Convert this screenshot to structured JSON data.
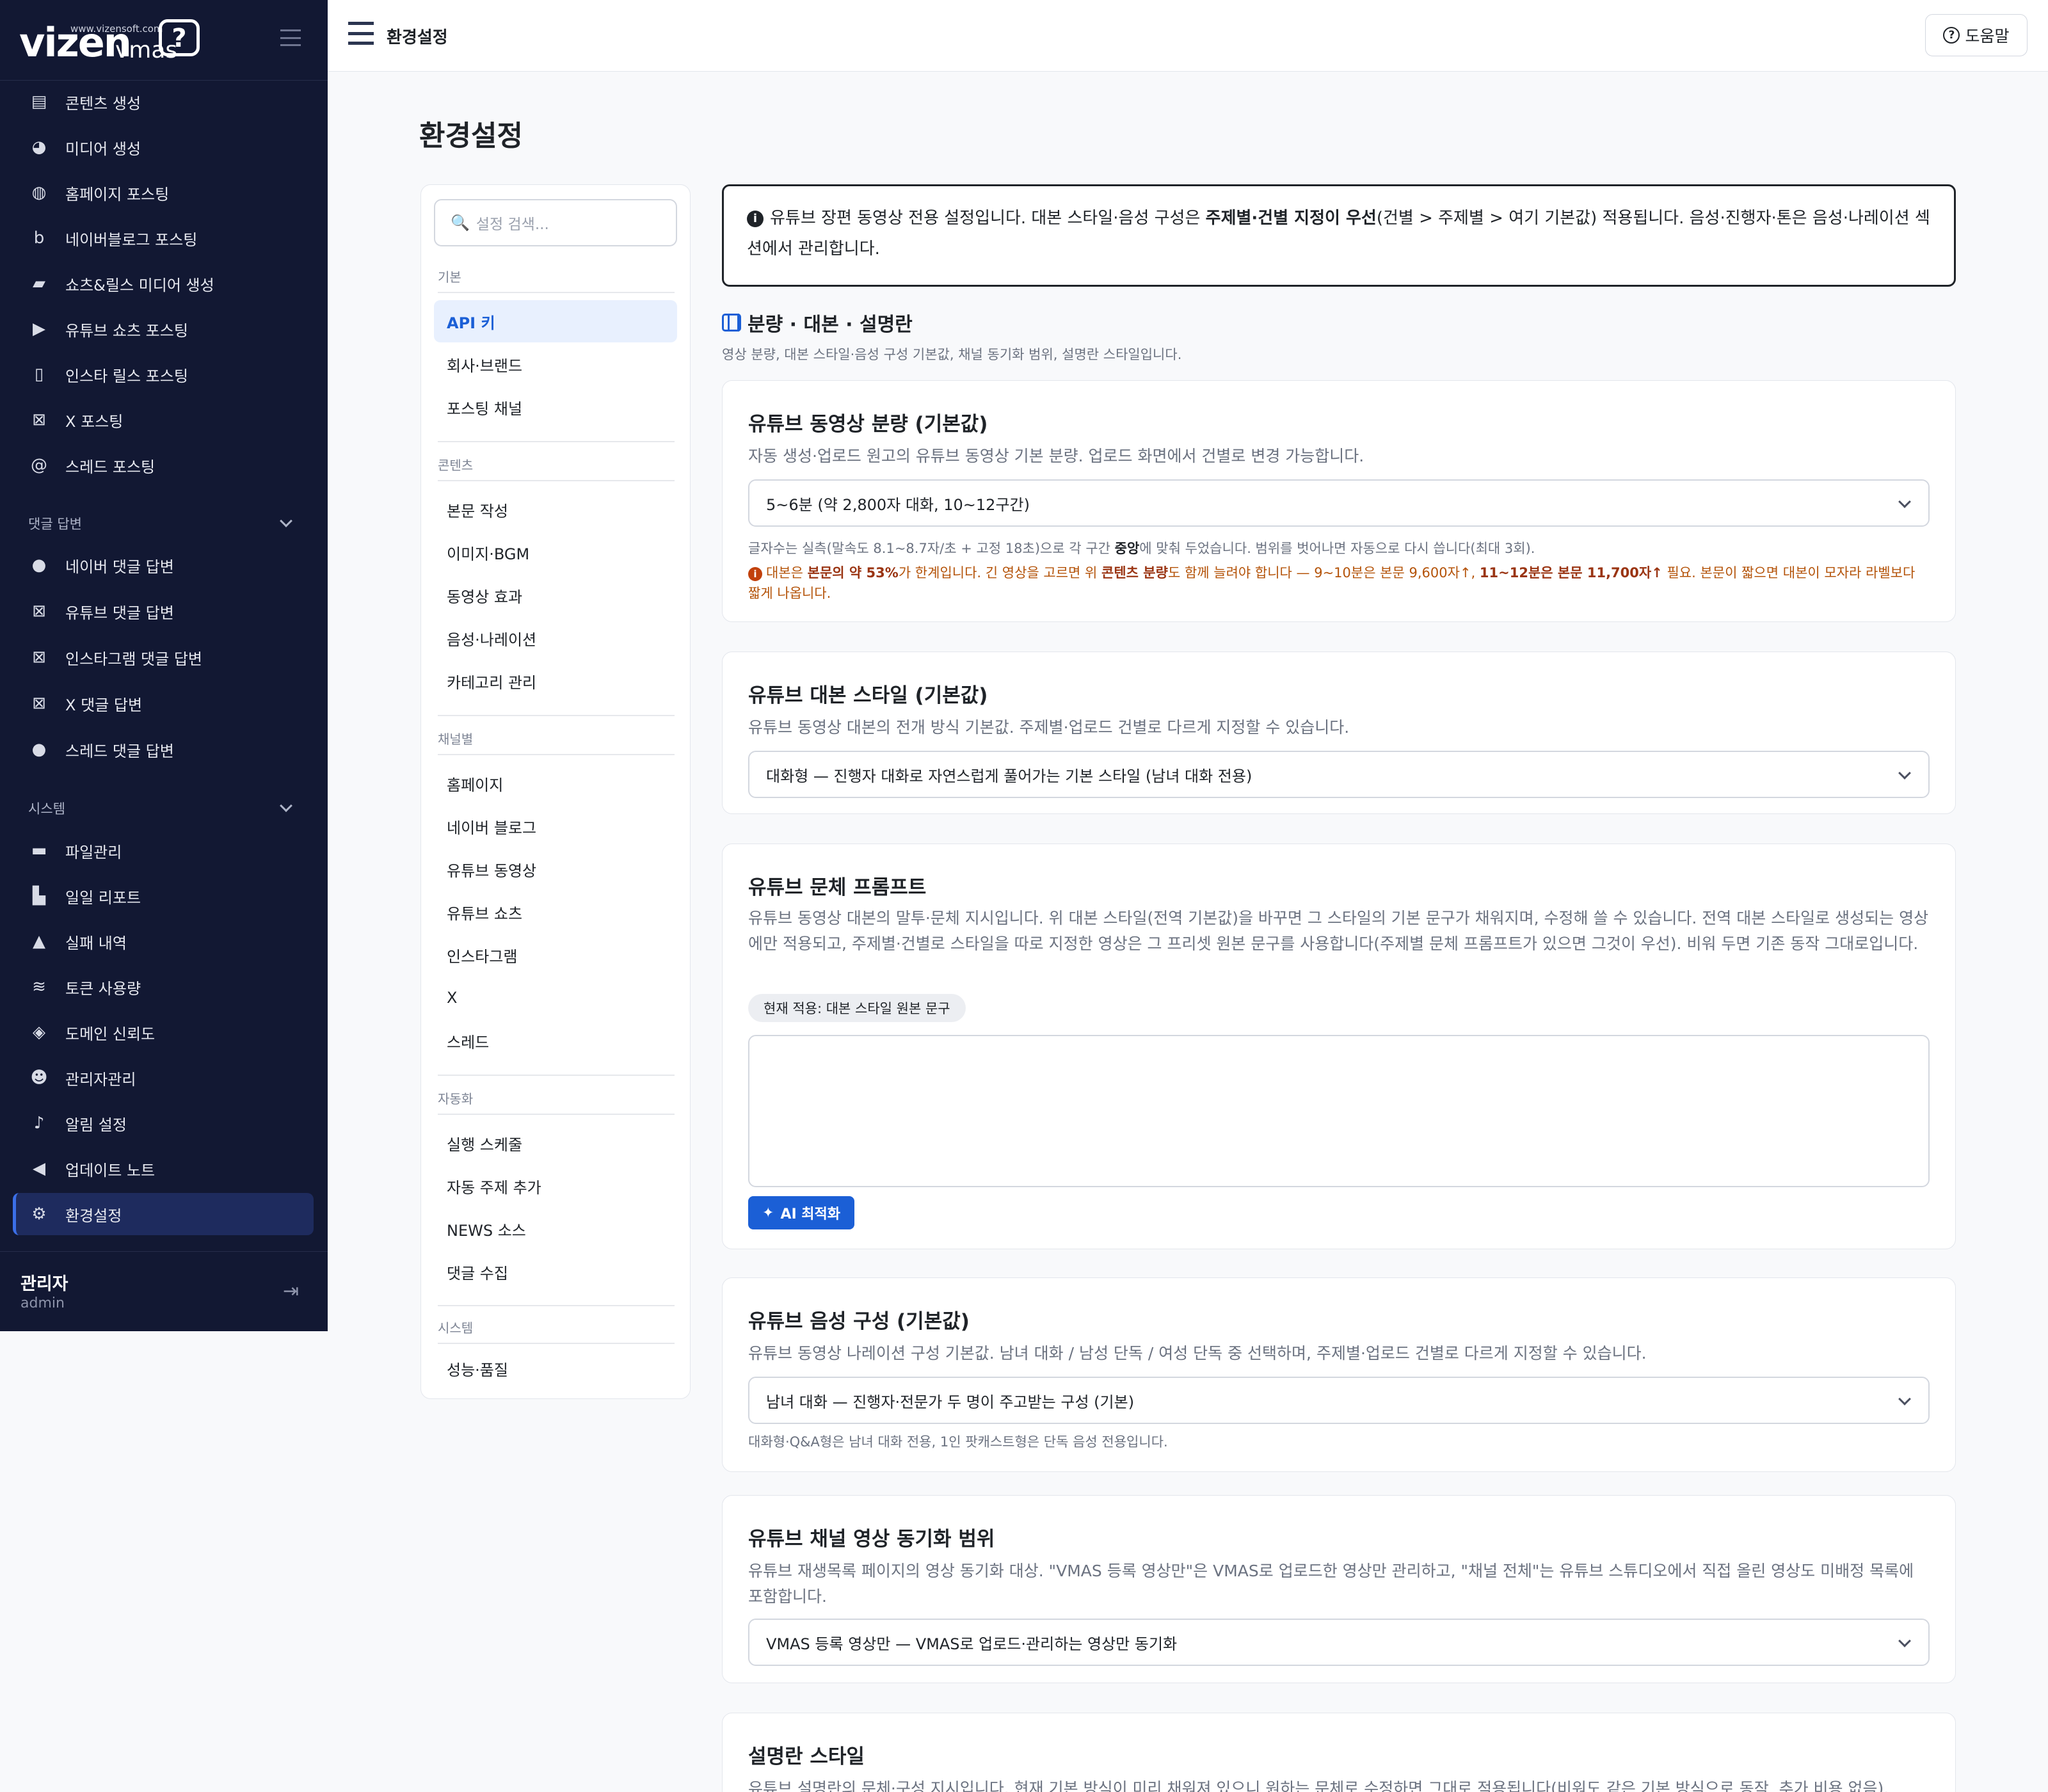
{
  "brand": {
    "logo_text": "vizen",
    "logo_sub": "vmas",
    "logo_url": "www.vizensoft.com"
  },
  "sidebar": {
    "items_top": [
      {
        "label": "콘텐츠 생성",
        "icon": "newspaper-icon"
      },
      {
        "label": "미디어 생성",
        "icon": "palette-icon"
      },
      {
        "label": "홈페이지 포스팅",
        "icon": "globe-icon"
      },
      {
        "label": "네이버블로그 포스팅",
        "icon": "blog-icon"
      },
      {
        "label": "쇼츠&릴스 미디어 생성",
        "icon": "clapperboard-icon"
      },
      {
        "label": "유튜브 쇼츠 포스팅",
        "icon": "play-icon"
      },
      {
        "label": "인스타 릴스 포스팅",
        "icon": "mobile-icon"
      },
      {
        "label": "X 포스팅",
        "icon": "x-icon"
      },
      {
        "label": "스레드 포스팅",
        "icon": "at-icon"
      }
    ],
    "group_comments": "댓글 답변",
    "items_comments": [
      {
        "label": "네이버 댓글 답변",
        "icon": "comment-icon"
      },
      {
        "label": "유튜브 댓글 답변",
        "icon": "x-icon"
      },
      {
        "label": "인스타그램 댓글 답변",
        "icon": "x-icon"
      },
      {
        "label": "X 댓글 답변",
        "icon": "x-icon"
      },
      {
        "label": "스레드 댓글 답변",
        "icon": "comments-icon"
      }
    ],
    "group_system": "시스템",
    "items_system": [
      {
        "label": "파일관리",
        "icon": "folder-icon"
      },
      {
        "label": "일일 리포트",
        "icon": "chart-icon"
      },
      {
        "label": "실패 내역",
        "icon": "warning-icon"
      },
      {
        "label": "토큰 사용량",
        "icon": "coins-icon"
      },
      {
        "label": "도메인 신뢰도",
        "icon": "shield-icon"
      },
      {
        "label": "관리자관리",
        "icon": "user-gear-icon"
      },
      {
        "label": "알림 설정",
        "icon": "bell-icon"
      },
      {
        "label": "업데이트 노트",
        "icon": "megaphone-icon"
      },
      {
        "label": "환경설정",
        "icon": "gear-icon",
        "active": true
      }
    ],
    "user": {
      "name": "관리자",
      "role": "admin"
    }
  },
  "topbar": {
    "breadcrumb": "환경설정",
    "help": "도움말"
  },
  "page_title": "환경설정",
  "settings_nav": {
    "search_placeholder": "설정 검색...",
    "groups": [
      {
        "title": "기본",
        "items": [
          "API 키",
          "회사·브랜드",
          "포스팅 채널"
        ]
      },
      {
        "title": "콘텐츠",
        "items": [
          "본문 작성",
          "이미지·BGM",
          "동영상 효과",
          "음성·나레이션",
          "카테고리 관리"
        ]
      },
      {
        "title": "채널별",
        "items": [
          "홈페이지",
          "네이버 블로그",
          "유튜브 동영상",
          "유튜브 쇼츠",
          "인스타그램",
          "X",
          "스레드"
        ]
      },
      {
        "title": "자동화",
        "items": [
          "실행 스케줄",
          "자동 주제 추가",
          "NEWS 소스",
          "댓글 수집"
        ]
      },
      {
        "title": "시스템",
        "items": [
          "성능·품질"
        ]
      }
    ],
    "active_item": "API 키"
  },
  "notice": {
    "text_a": "유튜브 장편 동영상 전용 설정입니다. 대본 스타일·음성 구성은 ",
    "text_bold": "주제별·건별 지정이 우선",
    "text_b": "(건별 > 주제별 > 여기 기본값) 적용됩니다. 음성·진행자·톤은 음성·나레이션 섹션에서 관리합니다."
  },
  "section": {
    "title": "분량 · 대본 · 설명란",
    "subtitle": "영상 분량, 대본 스타일·음성 구성 기본값, 채널 동기화 범위, 설명란 스타일입니다."
  },
  "cards": {
    "length": {
      "title": "유튜브 동영상 분량 (기본값)",
      "desc": "자동 생성·업로드 원고의 유튜브 동영상 기본 분량. 업로드 화면에서 건별로 변경 가능합니다.",
      "selected": "5~6분 (약 2,800자 대화, 10~12구간)",
      "note_a": "글자수는 실측(말속도 8.1~8.7자/초 + 고정 18초)으로 각 구간 ",
      "note_bold": "중앙",
      "note_b": "에 맞춰 두었습니다. 범위를 벗어나면 자동으로 다시 씁니다(최대 3회).",
      "warn_a": "대본은 ",
      "warn_bold1": "본문의 약 53%",
      "warn_b": "가 한계입니다. 긴 영상을 고르면 위 ",
      "warn_bold2": "콘텐츠 분량",
      "warn_c": "도 함께 늘려야 합니다 — 9~10분은 본문 9,600자↑, ",
      "warn_bold3": "11~12분은 본문 11,700자↑",
      "warn_d": " 필요. 본문이 짧으면 대본이 모자라 라벨보다 짧게 나옵니다."
    },
    "script_style": {
      "title": "유튜브 대본 스타일 (기본값)",
      "desc": "유튜브 동영상 대본의 전개 방식 기본값. 주제별·업로드 건별로 다르게 지정할 수 있습니다.",
      "selected": "대화형 — 진행자 대화로 자연스럽게 풀어가는 기본 스타일 (남녀 대화 전용)"
    },
    "tone_prompt": {
      "title": "유튜브 문체 프롬프트",
      "desc": "유튜브 동영상 대본의 말투·문체 지시입니다. 위 대본 스타일(전역 기본값)을 바꾸면 그 스타일의 기본 문구가 채워지며, 수정해 쓸 수 있습니다. 전역 대본 스타일로 생성되는 영상에만 적용되고, 주제별·건별로 스타일을 따로 지정한 영상은 그 프리셋 원본 문구를 사용합니다(주제별 문체 프롬프트가 있으면 그것이 우선). 비워 두면 기존 동작 그대로입니다.",
      "badge": "현재 적용: 대본 스타일 원본 문구",
      "value": "",
      "ai_button": "AI 최적화"
    },
    "voice": {
      "title": "유튜브 음성 구성 (기본값)",
      "desc": "유튜브 동영상 나레이션 구성 기본값. 남녀 대화 / 남성 단독 / 여성 단독 중 선택하며, 주제별·업로드 건별로 다르게 지정할 수 있습니다.",
      "selected": "남녀 대화 — 진행자·전문가 두 명이 주고받는 구성 (기본)",
      "note": "대화형·Q&A형은 남녀 대화 전용, 1인 팟캐스트형은 단독 음성 전용입니다."
    },
    "sync": {
      "title": "유튜브 채널 영상 동기화 범위",
      "desc": "유튜브 재생목록 페이지의 영상 동기화 대상. \"VMAS 등록 영상만\"은 VMAS로 업로드한 영상만 관리하고, \"채널 전체\"는 유튜브 스튜디오에서 직접 올린 영상도 미배정 목록에 포함합니다.",
      "selected": "VMAS 등록 영상만 — VMAS로 업로드·관리하는 영상만 동기화"
    },
    "desc_style": {
      "title": "설명란 스타일",
      "desc": "유튜브 설명란의 문체·구성 지시입니다. 현재 기본 방식이 미리 채워져 있으니 원하는 문체로 수정하면 그대로 적용됩니다(비워도 같은 기본 방식으로 동작, 추가 비용 없음)."
    }
  }
}
